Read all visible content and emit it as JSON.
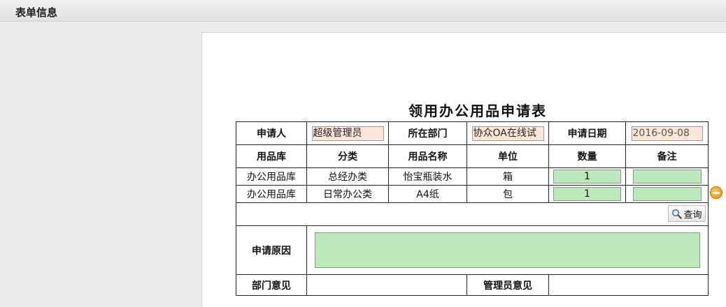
{
  "header": {
    "title": "表单信息"
  },
  "form": {
    "title": "领用办公用品申请表",
    "applicant_label": "申请人",
    "applicant_value": "超级管理员",
    "department_label": "所在部门",
    "department_value": "协众OA在线试",
    "date_label": "申请日期",
    "date_value": "2016-09-08",
    "columns": [
      "用品库",
      "分类",
      "用品名称",
      "单位",
      "数量",
      "备注"
    ],
    "rows": [
      {
        "warehouse": "办公用品库",
        "category": "总经办类",
        "item": "怡宝瓶装水",
        "unit": "箱",
        "quantity": "1",
        "note": ""
      },
      {
        "warehouse": "办公用品库",
        "category": "日常办公类",
        "item": "A4纸",
        "unit": "包",
        "quantity": "1",
        "note": ""
      }
    ],
    "search_label": "查询",
    "reason_label": "申请原因",
    "reason_value": "",
    "dept_opinion_label": "部门意见",
    "admin_opinion_label": "管理员意见"
  },
  "colors": {
    "input_peach": "#fde6d8",
    "input_green": "#bde7bd",
    "remove_icon": "#f08a00"
  }
}
